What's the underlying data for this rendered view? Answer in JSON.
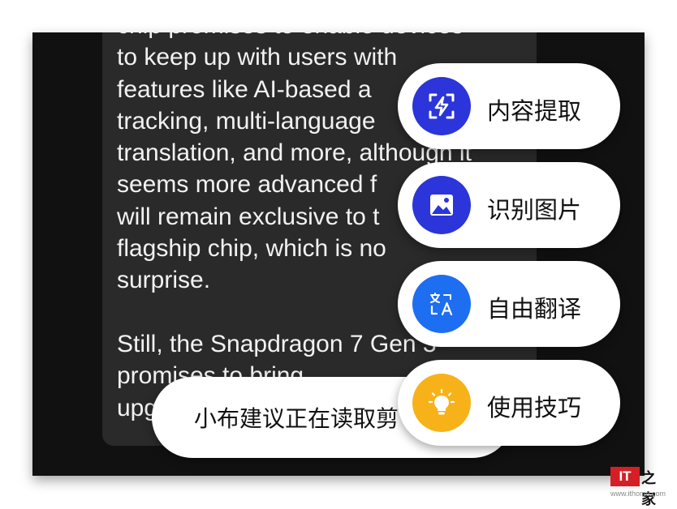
{
  "article": {
    "lines": [
      "chip promises to enable devices",
      "to keep up with users with",
      "features like AI-based a",
      "tracking, multi-language",
      "translation, and more, although it",
      "seems more advanced f",
      "will remain exclusive to t",
      "flagship chip, which is no",
      "surprise.",
      "",
      "Still, the Snapdragon 7 Gen 3",
      "promises to bring",
      "upg"
    ]
  },
  "toast": {
    "text": "小布建议正在读取剪"
  },
  "actions": [
    {
      "label": "内容提取",
      "icon": "content-extract-icon",
      "color": "#2b35d9"
    },
    {
      "label": "识别图片",
      "icon": "image-recognition-icon",
      "color": "#2b35d9"
    },
    {
      "label": "自由翻译",
      "icon": "translate-icon",
      "color": "#1d6ef0"
    },
    {
      "label": "使用技巧",
      "icon": "lightbulb-icon",
      "color": "#f7b21a"
    }
  ],
  "watermark": {
    "logo": "IT",
    "glyph": "之家",
    "url": "www.ithome.com"
  }
}
